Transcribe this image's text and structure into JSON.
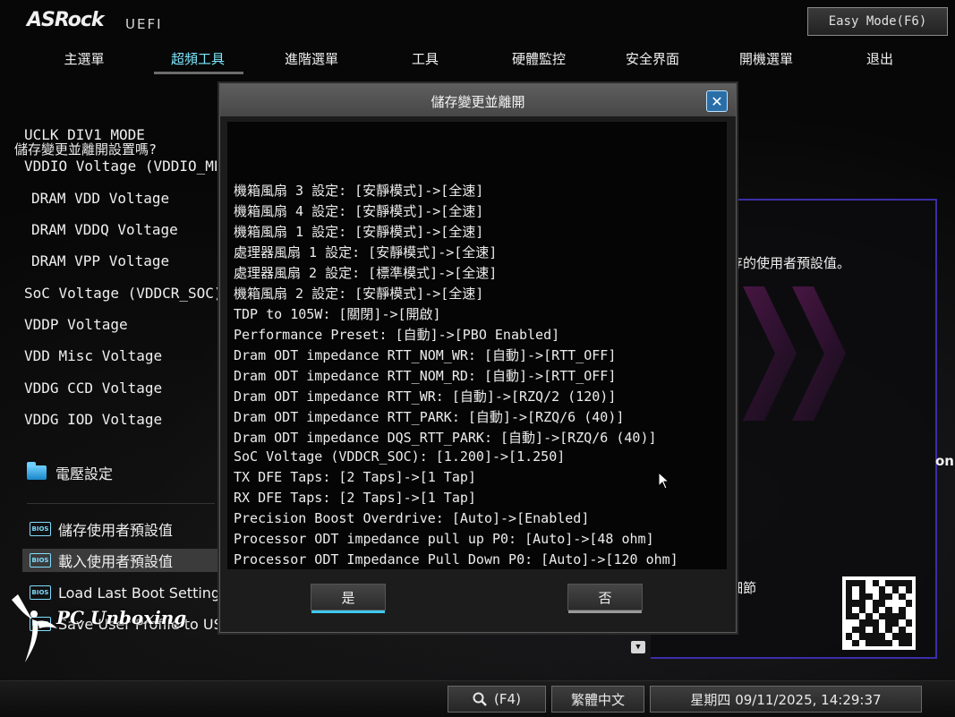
{
  "header": {
    "brand": "ASRock",
    "brand_sub": "UEFI",
    "easy_mode_label": "Easy Mode(F6)"
  },
  "tabs": [
    {
      "label": "主選單",
      "active": false
    },
    {
      "label": "超頻工具",
      "active": true
    },
    {
      "label": "進階選單",
      "active": false
    },
    {
      "label": "工具",
      "active": false
    },
    {
      "label": "硬體監控",
      "active": false
    },
    {
      "label": "安全界面",
      "active": false
    },
    {
      "label": "開機選單",
      "active": false
    },
    {
      "label": "退出",
      "active": false
    }
  ],
  "left_menu": {
    "items": [
      {
        "label": "UCLK DIV1 MODE",
        "sub": false
      },
      {
        "label": "VDDIO Voltage (VDDIO_MEM_S",
        "sub": false
      },
      {
        "label": "DRAM VDD Voltage",
        "sub": true
      },
      {
        "label": "DRAM VDDQ Voltage",
        "sub": true
      },
      {
        "label": "DRAM VPP Voltage",
        "sub": true
      },
      {
        "label": "SoC Voltage (VDDCR_SOC)",
        "sub": false
      },
      {
        "label": "VDDP Voltage",
        "sub": false
      },
      {
        "label": "VDD Misc Voltage",
        "sub": false
      },
      {
        "label": "VDDG CCD Voltage",
        "sub": false
      },
      {
        "label": "VDDG IOD Voltage",
        "sub": false
      }
    ],
    "folder_label": "電壓設定",
    "bios_icon_text": "BIOS",
    "bios_items": [
      {
        "label": "儲存使用者預設值",
        "selected": false
      },
      {
        "label": "載入使用者預設值",
        "selected": true
      },
      {
        "label": "Load Last Boot Setting",
        "selected": false
      },
      {
        "label": "Save User Profile to USB Flash drive",
        "selected": false
      }
    ]
  },
  "right_panel": {
    "description": "存的使用者預設值。",
    "details": "細節",
    "edge_text": "on"
  },
  "dialog": {
    "title": "儲存變更並離開",
    "close_glyph": "✕",
    "question": "儲存變更並離開設置嗎?",
    "changes": [
      "機箱風扇 3 設定: [安靜模式]->[全速]",
      "機箱風扇 4 設定: [安靜模式]->[全速]",
      "機箱風扇 1 設定: [安靜模式]->[全速]",
      "處理器風扇 1 設定: [安靜模式]->[全速]",
      "處理器風扇 2 設定: [標準模式]->[全速]",
      "機箱風扇 2 設定: [安靜模式]->[全速]",
      "TDP to 105W: [關閉]->[開啟]",
      "Performance Preset: [自動]->[PBO Enabled]",
      "Dram ODT impedance RTT_NOM_WR: [自動]->[RTT_OFF]",
      "Dram ODT impedance RTT_NOM_RD: [自動]->[RTT_OFF]",
      "Dram ODT impedance RTT_WR: [自動]->[RZQ/2 (120)]",
      "Dram ODT impedance RTT_PARK: [自動]->[RZQ/6 (40)]",
      "Dram ODT impedance DQS_RTT_PARK: [自動]->[RZQ/6 (40)]",
      "SoC Voltage (VDDCR_SOC): [1.200]->[1.250]",
      "TX DFE Taps: [2 Taps]->[1 Tap]",
      "RX DFE Taps: [2 Taps]->[1 Tap]",
      "Precision Boost Overdrive: [Auto]->[Enabled]",
      "Processor ODT impedance pull up P0: [Auto]->[48 ohm]",
      "Processor ODT Impedance Pull Down P0: [Auto]->[120 ohm]"
    ],
    "yes_label": "是",
    "no_label": "否"
  },
  "watermark": "PC Unboxing",
  "status_bar": {
    "search_label": "(F4)",
    "language": "繁體中文",
    "datetime": "星期四 09/11/2025, 14:29:37"
  },
  "colors": {
    "active_tab": "#7fe8ff",
    "yes_accent": "#3fc8f0",
    "panel_border": "#3b2ea8"
  }
}
